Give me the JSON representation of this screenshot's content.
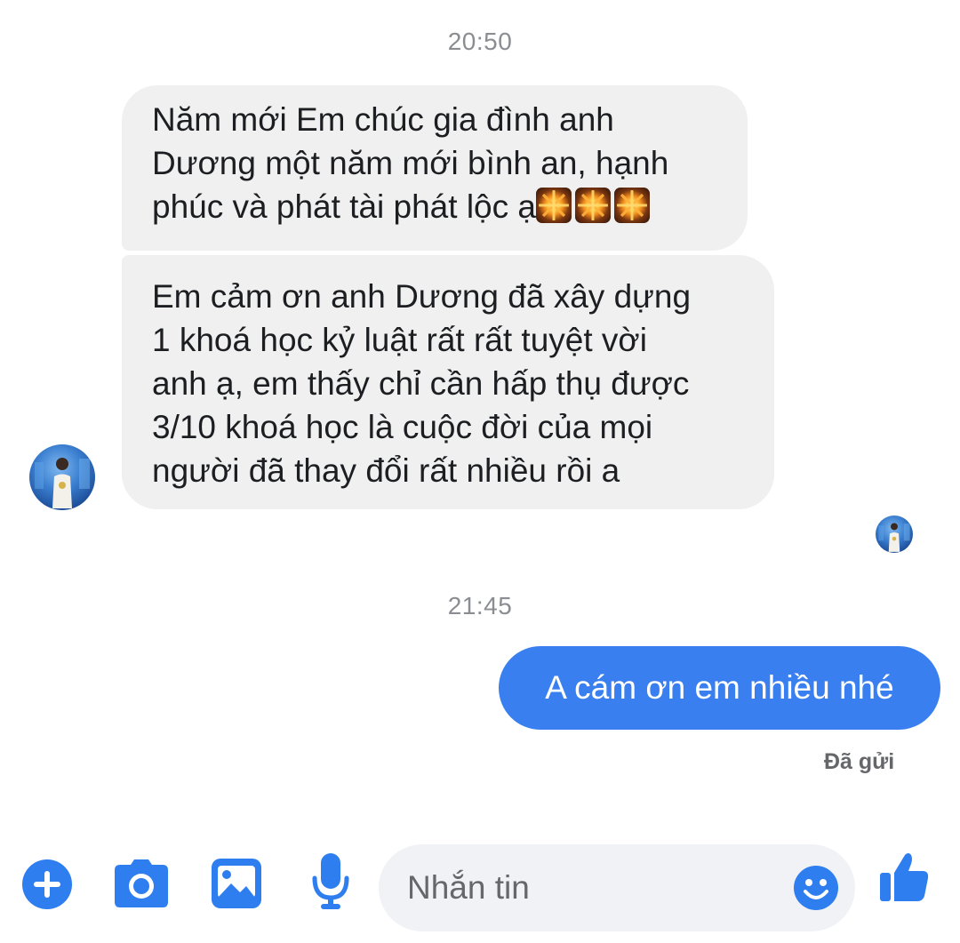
{
  "conversation": {
    "timestamps": [
      "20:50",
      "21:45"
    ],
    "incoming_message_1": {
      "lines": [
        "Năm mới Em chúc gia đình anh",
        "Dương một năm mới bình an, hạnh",
        "phúc và phát tài phát lộc ạ"
      ],
      "emoji": "fireworks"
    },
    "incoming_message_2": {
      "lines": [
        "Em cảm ơn anh Dương đã xây dựng",
        "1 khoá học kỷ luật rất rất tuyệt vời",
        "anh ạ, em thấy chỉ cần hấp thụ được",
        "3/10 khoá học là cuộc đời của mọi",
        "người đã thay đổi rất nhiều rồi a"
      ]
    },
    "outgoing_message": {
      "text": "A cám ơn em nhiều nhé",
      "status": "Đã gửi"
    }
  },
  "composer": {
    "placeholder": "Nhắn tin",
    "icons": [
      "plus-icon",
      "camera-icon",
      "image-icon",
      "microphone-icon",
      "emoji-icon",
      "thumbs-up-icon"
    ]
  },
  "colors": {
    "accent": "#3a7ff0",
    "incoming_bubble": "#f0f0f0",
    "timestamp": "#8a8d91",
    "icon_blue": "#2e7ef0"
  }
}
